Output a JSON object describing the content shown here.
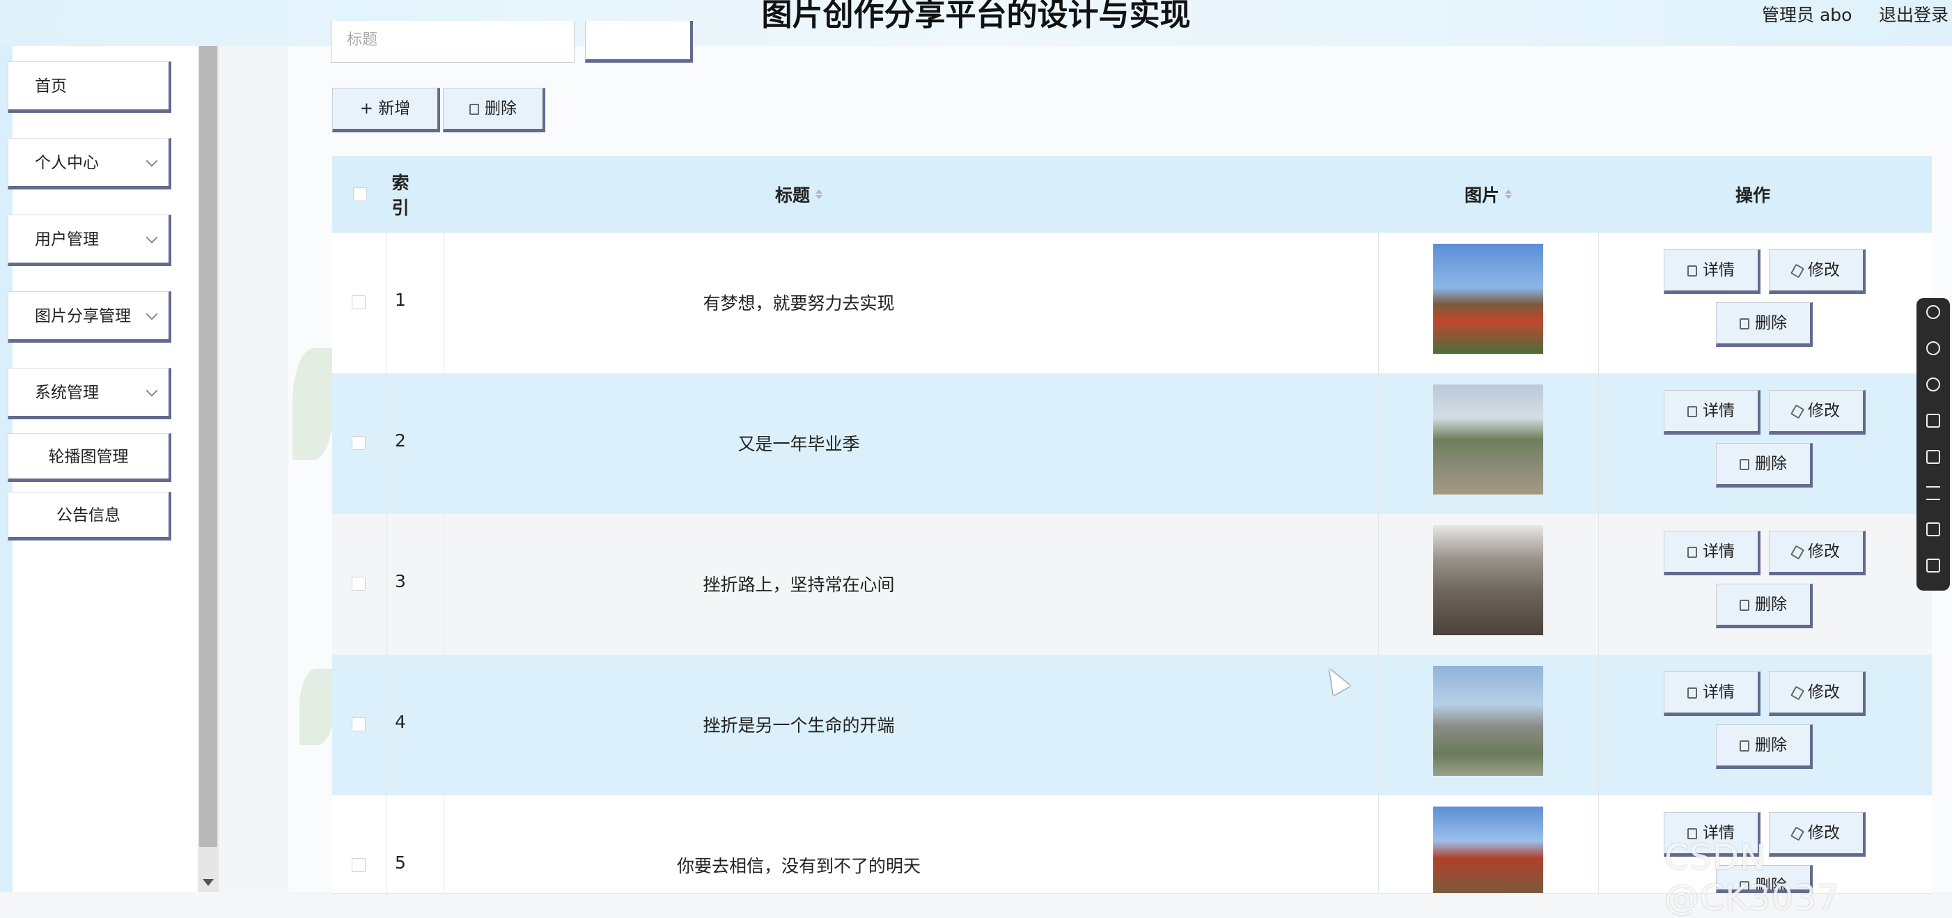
{
  "header": {
    "title": "图片创作分享平台的设计与实现",
    "admin_label": "管理员 abo",
    "logout": "退出登录"
  },
  "sidebar": {
    "items": [
      {
        "label": "首页"
      },
      {
        "label": "个人中心"
      },
      {
        "label": "用户管理"
      },
      {
        "label": "图片分享管理"
      },
      {
        "label": "系统管理"
      }
    ],
    "sub_items": [
      {
        "label": "轮播图管理"
      },
      {
        "label": "公告信息"
      }
    ]
  },
  "search": {
    "placeholder": "标题"
  },
  "toolbar": {
    "add_label": "+ 新增",
    "delete_label": "删除"
  },
  "table": {
    "columns": [
      "索引",
      "标题",
      "图片",
      "操作"
    ],
    "rows": [
      {
        "index": "1",
        "title": "有梦想，就要努力去实现"
      },
      {
        "index": "2",
        "title": "又是一年毕业季"
      },
      {
        "index": "3",
        "title": "挫折路上，坚持常在心间"
      },
      {
        "index": "4",
        "title": "挫折是另一个生命的开端"
      },
      {
        "index": "5",
        "title": "你要去相信，没有到不了的明天"
      }
    ],
    "actions": {
      "detail": "详情",
      "edit": "修改",
      "delete": "删除"
    }
  },
  "watermark": "CSDN @CK3037",
  "colors": {
    "header_bg": "#dff1fb",
    "row_highlight": "#dcf0fb",
    "button_border": "#636a8e"
  }
}
